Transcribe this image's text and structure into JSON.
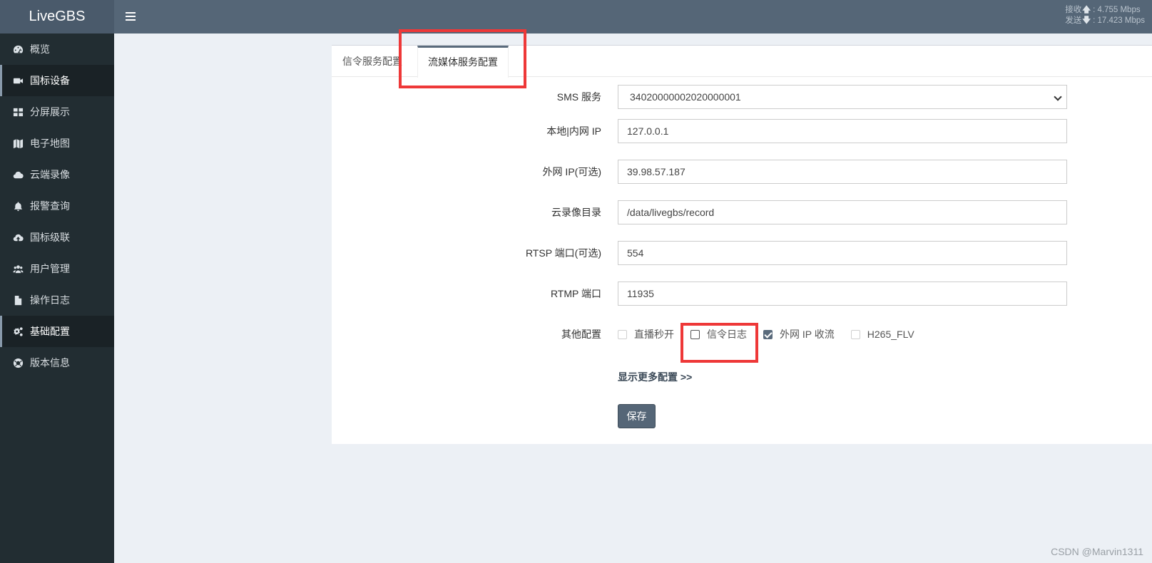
{
  "app": {
    "title": "LiveGBS"
  },
  "header": {
    "receive_label": "接收",
    "receive_value": "4.755 Mbps",
    "send_label": "发送",
    "send_value": "17.423 Mbps"
  },
  "sidebar": {
    "items": [
      {
        "label": "概览",
        "icon": "dashboard-icon"
      },
      {
        "label": "国标设备",
        "icon": "video-camera-icon",
        "active": true
      },
      {
        "label": "分屏展示",
        "icon": "grid-icon"
      },
      {
        "label": "电子地图",
        "icon": "map-icon"
      },
      {
        "label": "云端录像",
        "icon": "cloud-icon"
      },
      {
        "label": "报警查询",
        "icon": "bell-icon"
      },
      {
        "label": "国标级联",
        "icon": "cloud-upload-icon"
      },
      {
        "label": "用户管理",
        "icon": "users-icon"
      },
      {
        "label": "操作日志",
        "icon": "file-icon"
      },
      {
        "label": "基础配置",
        "icon": "gears-icon",
        "active": true
      },
      {
        "label": "版本信息",
        "icon": "life-ring-icon"
      }
    ]
  },
  "tabs": [
    {
      "label": "信令服务配置"
    },
    {
      "label": "流媒体服务配置",
      "active": true
    }
  ],
  "form": {
    "sms": {
      "label": "SMS 服务",
      "value": "34020000002020000001"
    },
    "local_ip": {
      "label": "本地|内网 IP",
      "value": "127.0.0.1"
    },
    "external_ip": {
      "label": "外网 IP(可选)",
      "value": "39.98.57.187"
    },
    "record_dir": {
      "label": "云录像目录",
      "value": "/data/livegbs/record"
    },
    "rtsp_port": {
      "label": "RTSP 端口(可选)",
      "value": "554"
    },
    "rtmp_port": {
      "label": "RTMP 端口",
      "value": "11935"
    },
    "other": {
      "label": "其他配置",
      "options": [
        {
          "label": "直播秒开",
          "checked": false
        },
        {
          "label": "信令日志",
          "checked": false
        },
        {
          "label": "外网 IP 收流",
          "checked": true
        },
        {
          "label": "H265_FLV",
          "checked": false
        }
      ]
    },
    "more_link": "显示更多配置  >>",
    "save_label": "保存"
  },
  "watermark": "CSDN @Marvin1311",
  "colors": {
    "highlight": "#ee3838",
    "sidebar": "#222d32",
    "header": "#556677",
    "accent": "#5a6b7c"
  }
}
